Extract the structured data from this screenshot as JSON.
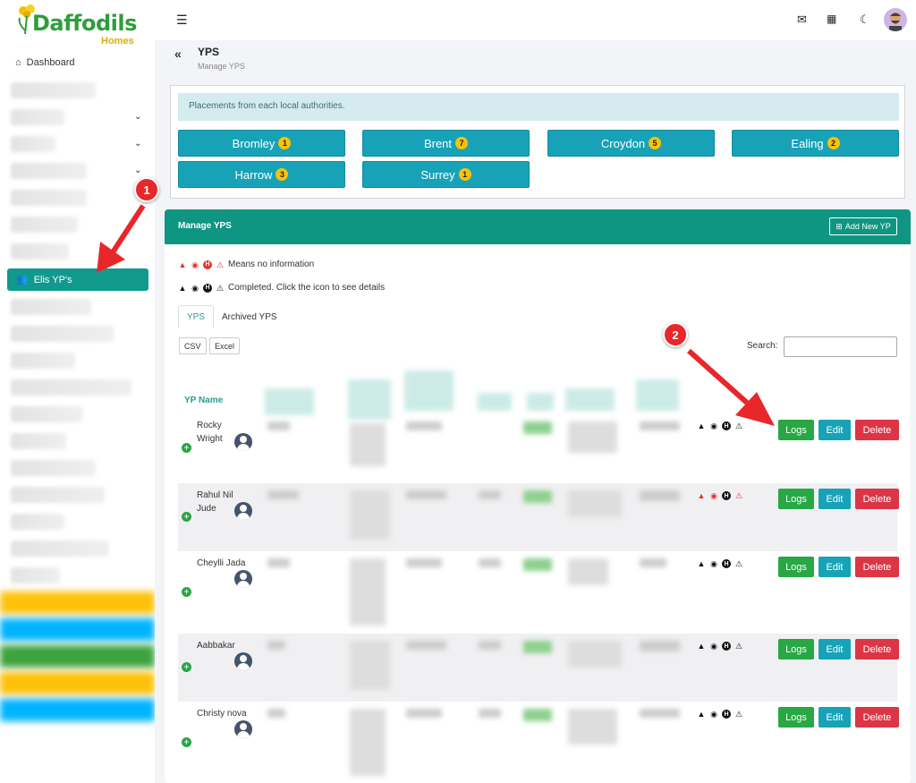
{
  "brand": {
    "name": "Daffodils",
    "sub": "Homes"
  },
  "sidebar": {
    "dashboard_label": "Dashboard",
    "active_label": "Elis YP's"
  },
  "header": {
    "title": "YPS",
    "subtitle": "Manage YPS"
  },
  "authorities": {
    "info": "Placements from each local authorities.",
    "items": [
      {
        "name": "Bromley",
        "count": "1"
      },
      {
        "name": "Brent",
        "count": "7"
      },
      {
        "name": "Croydon",
        "count": "5"
      },
      {
        "name": "Ealing",
        "count": "2"
      },
      {
        "name": "Harrow",
        "count": "3"
      },
      {
        "name": "Surrey",
        "count": "1"
      }
    ]
  },
  "manage": {
    "title": "Manage YPS",
    "add_label": "Add New YP",
    "legend_missing": "Means no information",
    "legend_done": "Completed. Click the icon to see details",
    "tabs": [
      "YPS",
      "Archived YPS"
    ],
    "export_buttons": [
      "CSV",
      "Excel"
    ],
    "search_label": "Search:",
    "column_name": "YP Name",
    "actions": {
      "logs": "Logs",
      "edit": "Edit",
      "delete": "Delete"
    },
    "rows": [
      {
        "name": "Rocky Wright"
      },
      {
        "name": "Rahul Nil Jude"
      },
      {
        "name": "Cheylli Jada"
      },
      {
        "name": "Aabbakar"
      },
      {
        "name": "Christy nova"
      }
    ]
  },
  "annotations": {
    "marker1": "1",
    "marker2": "2"
  },
  "colors": {
    "accent": "#0f9682",
    "teal": "#17a2b8",
    "green": "#28a745",
    "red": "#dc3545",
    "badge": "#ffc107"
  }
}
